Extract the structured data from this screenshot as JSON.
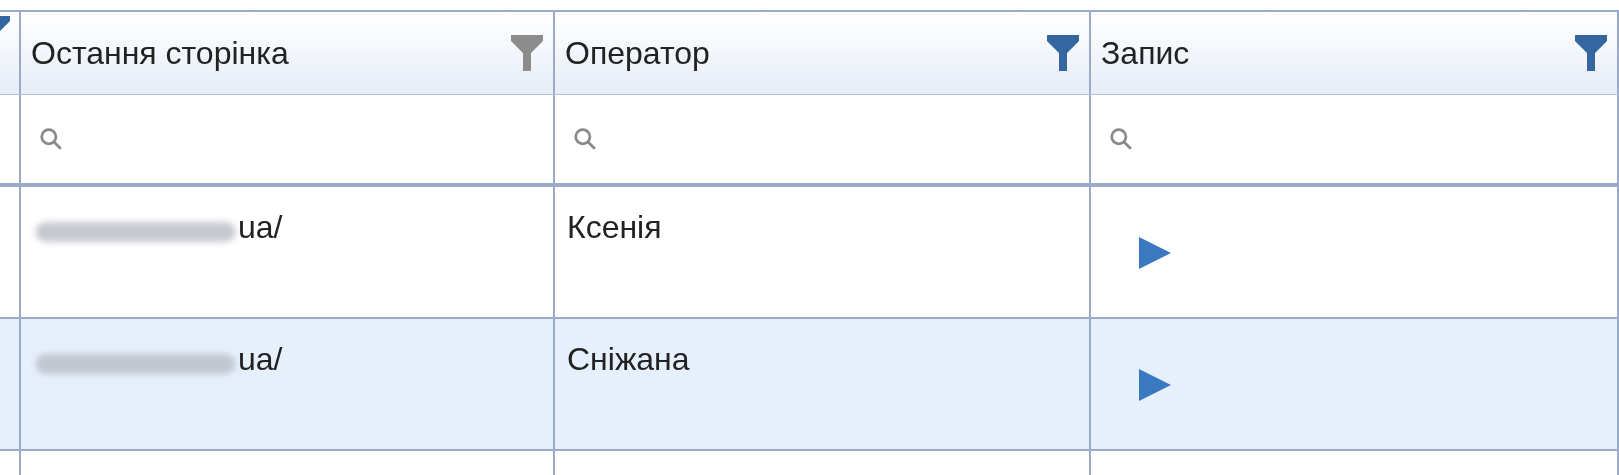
{
  "columns": [
    {
      "filter_active": true
    },
    {
      "label": "Остання сторінка",
      "filter_active": false
    },
    {
      "label": "Оператор",
      "filter_active": true
    },
    {
      "label": "Запис",
      "filter_active": true
    }
  ],
  "rows": [
    {
      "last_page": "ua/",
      "last_page_redacted": true,
      "operator": "Ксенія",
      "recording": true,
      "selected": false
    },
    {
      "last_page": "ua/",
      "last_page_redacted": true,
      "operator": "Сніжана",
      "recording": true,
      "selected": true
    },
    {
      "selected": false
    }
  ]
}
